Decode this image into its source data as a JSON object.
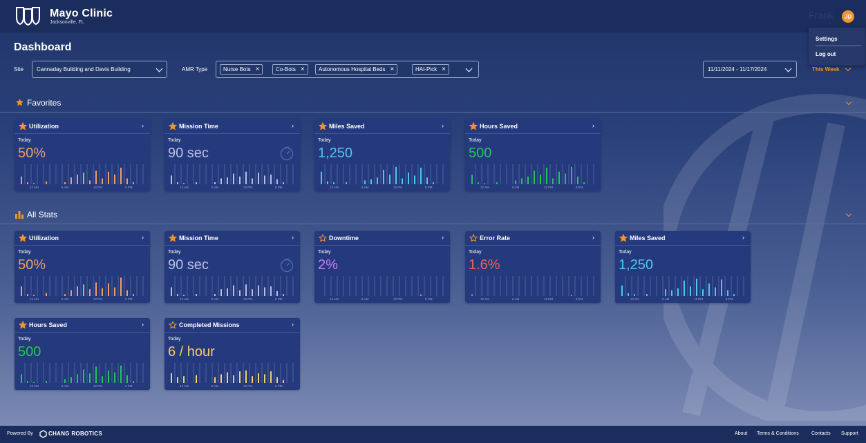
{
  "header": {
    "brand": "Mayo Clinic",
    "location": "Jacksonville, FL",
    "user_name": "Frank",
    "user_initials": "JD"
  },
  "user_menu": {
    "items": [
      "Settings",
      "Log out"
    ]
  },
  "page": {
    "title": "Dashboard"
  },
  "filters": {
    "site_label": "Site",
    "site_value": "Cannaday Building and Davis Building",
    "amr_label": "AMR Type",
    "amr_chips": [
      "Nurse Bots",
      "Co-Bots",
      "Autonomous Hospital Beds",
      "HAI-Pick"
    ],
    "date_range": "11/11/2024  -  11/17/2024",
    "range_preset": "This Week"
  },
  "sections": {
    "favorites": "Favorites",
    "all_stats": "All Stats"
  },
  "colors": {
    "accent": "#f0952b",
    "orange": "#f0a060",
    "lavender": "#b9bfe6",
    "cyan": "#4fc8f0",
    "green": "#22c55e",
    "violet": "#c77dff",
    "red": "#f0605a",
    "yellow": "#f3d06a"
  },
  "chart_ticks": [
    "12 AM",
    "6 AM",
    "12 PM",
    "6 PM"
  ],
  "favorites": [
    {
      "title": "Utilization",
      "starred": true,
      "period": "Today",
      "value": "50%",
      "color": "orange",
      "bars": [
        0.4,
        0.1,
        0.05,
        0,
        0.15,
        0,
        0,
        0.1,
        0.35,
        0.5,
        0.6,
        0.2,
        0.7,
        0.3,
        0.65,
        0.5,
        0.85,
        0.3,
        0.1,
        0
      ]
    },
    {
      "title": "Mission Time",
      "starred": true,
      "period": "Today",
      "value": "90 sec",
      "color": "lavender",
      "clock": true,
      "bars": [
        0.45,
        0.1,
        0.05,
        0,
        0.1,
        0,
        0,
        0.1,
        0.3,
        0.35,
        0.55,
        0.4,
        0.65,
        0.3,
        0.6,
        0.45,
        0.5,
        0.25,
        0.1,
        0
      ]
    },
    {
      "title": "Miles Saved",
      "starred": true,
      "period": "Today",
      "value": "1,250",
      "color": "cyan",
      "bars": [
        0.65,
        0.15,
        0.1,
        0,
        0.1,
        0,
        0,
        0.2,
        0.25,
        0.35,
        0.75,
        0.5,
        0.9,
        0.3,
        0.6,
        0.45,
        0.85,
        0.35,
        0.1,
        0
      ]
    },
    {
      "title": "Hours Saved",
      "starred": true,
      "period": "Today",
      "value": "500",
      "color": "green",
      "bars": [
        0.5,
        0.1,
        0.05,
        0,
        0.1,
        0,
        0,
        0.2,
        0.3,
        0.4,
        0.7,
        0.5,
        0.85,
        0.3,
        0.65,
        0.55,
        0.9,
        0.4,
        0.1,
        0
      ]
    }
  ],
  "all_stats": [
    {
      "title": "Utilization",
      "starred": true,
      "period": "Today",
      "value": "50%",
      "color": "orange",
      "bars": [
        0.5,
        0.1,
        0.05,
        0,
        0.15,
        0,
        0,
        0.1,
        0.3,
        0.5,
        0.6,
        0.35,
        0.7,
        0.4,
        0.65,
        0.45,
        0.95,
        0.3,
        0.1,
        0
      ]
    },
    {
      "title": "Mission Time",
      "starred": true,
      "period": "Today",
      "value": "90 sec",
      "color": "lavender",
      "clock": true,
      "bars": [
        0.45,
        0.1,
        0.05,
        0,
        0.1,
        0,
        0,
        0.1,
        0.35,
        0.4,
        0.55,
        0.3,
        0.6,
        0.35,
        0.55,
        0.45,
        0.5,
        0.25,
        0.1,
        0
      ]
    },
    {
      "title": "Downtime",
      "starred": false,
      "period": "Today",
      "value": "2%",
      "color": "violet",
      "bars": [
        0,
        0,
        0,
        0,
        0,
        0,
        0,
        0,
        0,
        0,
        0,
        0,
        0,
        0,
        0,
        0,
        0.08,
        0,
        0,
        0
      ]
    },
    {
      "title": "Error Rate",
      "starred": false,
      "period": "Today",
      "value": "1.6%",
      "color": "red",
      "bars": [
        0.1,
        0,
        0,
        0,
        0,
        0,
        0,
        0,
        0,
        0,
        0,
        0,
        0,
        0,
        0,
        0,
        0.06,
        0,
        0,
        0
      ]
    },
    {
      "title": "Miles Saved",
      "starred": true,
      "period": "Today",
      "value": "1,250",
      "color": "cyan",
      "bars": [
        0.55,
        0.15,
        0.1,
        0,
        0.1,
        0,
        0,
        0.35,
        0.3,
        0.4,
        0.8,
        0.5,
        0.9,
        0.35,
        0.65,
        0.45,
        0.85,
        0.3,
        0.1,
        0
      ]
    },
    {
      "title": "Hours Saved",
      "starred": true,
      "period": "Today",
      "value": "500",
      "color": "green",
      "bars": [
        0.45,
        0.1,
        0.05,
        0,
        0.1,
        0,
        0,
        0.2,
        0.3,
        0.45,
        0.7,
        0.5,
        0.85,
        0.35,
        0.65,
        0.55,
        0.9,
        0.4,
        0.1,
        0
      ]
    },
    {
      "title": "Completed Missions",
      "starred": false,
      "period": "Today",
      "value": "6 / hour",
      "color": "yellow",
      "bars": [
        0.5,
        0.3,
        0.35,
        0,
        0.4,
        0,
        0,
        0.3,
        0.45,
        0.55,
        0.4,
        0.6,
        0.65,
        0.35,
        0.5,
        0.45,
        0.6,
        0.3,
        0.15,
        0
      ]
    }
  ],
  "footer": {
    "powered_by": "Powered By",
    "company": "CHANG ROBOTICS",
    "links": [
      "About",
      "Terms & Conditions",
      "Contacts",
      "Support"
    ]
  }
}
